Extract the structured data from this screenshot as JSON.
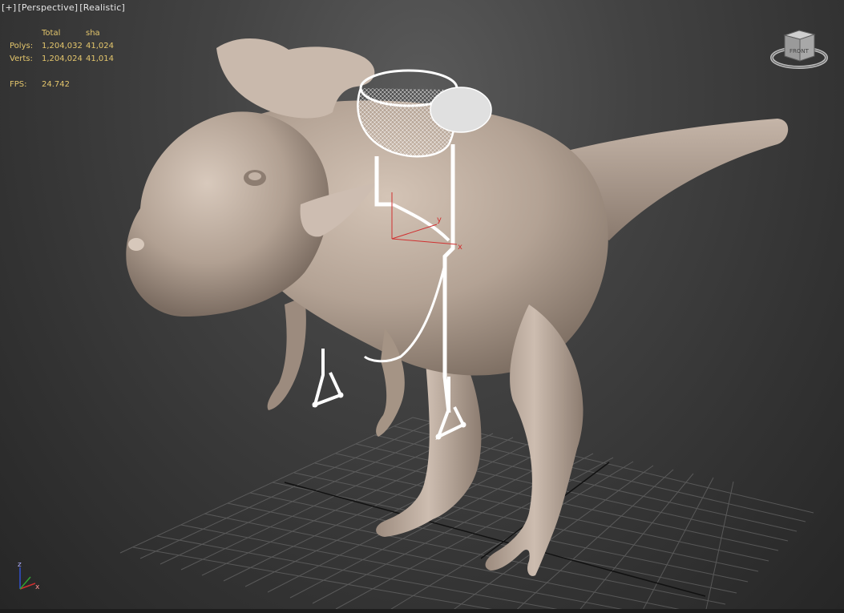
{
  "viewport": {
    "menu_plus": "[+]",
    "view_mode": "[Perspective]",
    "shading_mode": "[Realistic]"
  },
  "stats": {
    "header_total": "Total",
    "header_sel": "sha",
    "polys_label": "Polys:",
    "polys_total": "1,204,032",
    "polys_sel": "41,024",
    "verts_label": "Verts:",
    "verts_total": "1,204,024",
    "verts_sel": "41,014",
    "fps_label": "FPS:",
    "fps_value": "24.742"
  },
  "axis_labels": {
    "gizmo_x": "x",
    "gizmo_y": "y",
    "tripod_z": "z",
    "tripod_x": "x"
  },
  "viewcube": {
    "face_label": "FRONT"
  },
  "colors": {
    "stats_text": "#e4c66c",
    "model_skin": "#b8a89b",
    "wireframe": "#ffffff",
    "grid_line": "#6a6a6a",
    "axis_x": "#d03030",
    "axis_y": "#d03030",
    "axis_z": "#3050d0"
  }
}
